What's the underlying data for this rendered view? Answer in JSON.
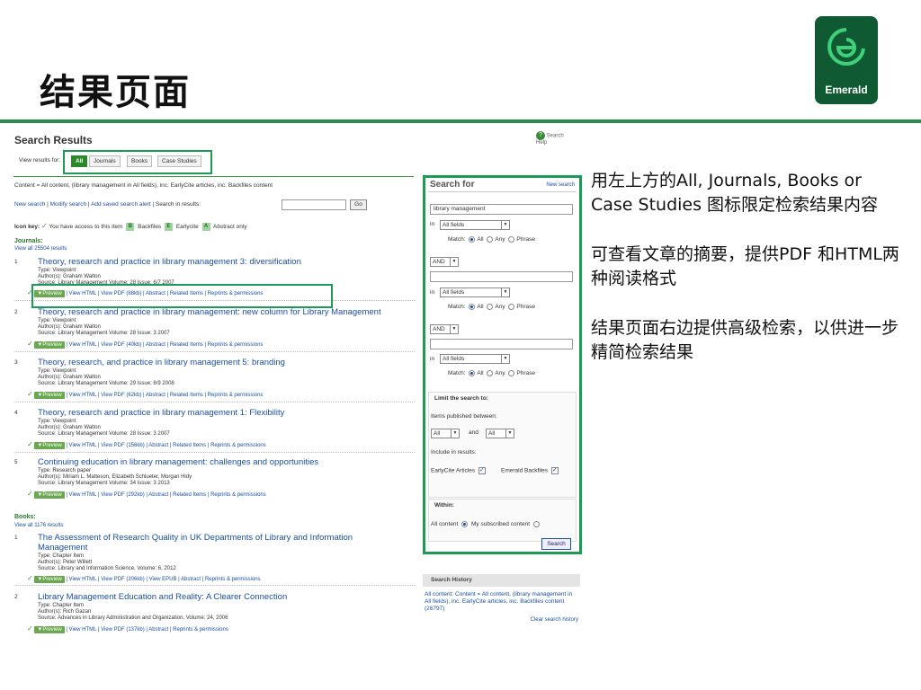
{
  "slide_title": "结果页面",
  "logo": {
    "text": "Emerald",
    "brand_color": "#0f5a32",
    "accent": "#1d9a55"
  },
  "screenshot": {
    "title": "Search Results",
    "help": "Search Help",
    "view_results_for": "View results for:",
    "tabs": [
      "All",
      "Journals",
      "Books",
      "Case Studies"
    ],
    "content_line": "Content = All content, (library management in All fields), inc. EarlyCite articles, inc. Backfiles content",
    "links": {
      "new_search": "New search",
      "modify_search": "Modify search",
      "add_alert": "Add saved search alert",
      "search_in_results": "Search in results:",
      "go": "Go"
    },
    "icon_key": {
      "label": "Icon key:",
      "access": "You have access to this item",
      "b": "B",
      "backfiles": "Backfiles",
      "e": "E",
      "earlycite": "Earlycite",
      "a": "A",
      "abstract_only": "Abstract only"
    },
    "journals": {
      "heading": "Journals:",
      "view_all": "View all 25504 results",
      "results": [
        {
          "num": "1",
          "title": "Theory, research and practice in library management 3: diversification",
          "type": "Type: Viewpoint",
          "authors": "Author(s): Graham Walton",
          "source": "Source: Library Management Volume: 28 Issue: 6/7 2007",
          "actions": "| View HTML | View PDF (88kb) | Abstract | Related Items | Reprints & permissions"
        },
        {
          "num": "2",
          "title": "Theory, research and practice in library management: new column for Library Management",
          "type": "Type: Viewpoint",
          "authors": "Author(s): Graham Walton",
          "source": "Source: Library Management Volume: 28 Issue: 3 2007",
          "actions": "| View HTML | View PDF (40kb) | Abstract | Related Items | Reprints & permissions"
        },
        {
          "num": "3",
          "title": "Theory, research, and practice in library management 5: branding",
          "type": "Type: Viewpoint",
          "authors": "Author(s): Graham Walton",
          "source": "Source: Library Management Volume: 29 Issue: 8/9 2008",
          "actions": "| View HTML | View PDF (62kb) | Abstract | Related Items | Reprints & permissions"
        },
        {
          "num": "4",
          "title": "Theory, research and practice in library management 1: Flexibility",
          "type": "Type: Viewpoint",
          "authors": "Author(s): Graham Walton",
          "source": "Source: Library Management Volume: 28 Issue: 3 2007",
          "actions": "| View HTML | View PDF (156kb) | Abstract | Related Items | Reprints & permissions"
        },
        {
          "num": "5",
          "title": "Continuing education in library management: challenges and opportunities",
          "type": "Type: Research paper",
          "authors": "Author(s): Miriam L. Matteson, Elizabeth Schlueter, Morgan Hidy",
          "source": "Source: Library Management Volume: 34 Issue: 3 2013",
          "actions": "| View HTML | View PDF (292kb) | Abstract | Related Items | Reprints & permissions"
        }
      ]
    },
    "books": {
      "heading": "Books:",
      "view_all": "View all 1176 results",
      "results": [
        {
          "num": "1",
          "title": "The Assessment of Research Quality in UK Departments of Library and Information Management",
          "type": "Type: Chapter Item",
          "authors": "Author(s): Peter Willett",
          "source": "Source: Library and Information Science, Volume: 6, 2012",
          "actions": "| View HTML | View PDF (206kb) | View EPUB | Abstract | Reprints & permissions"
        },
        {
          "num": "2",
          "title": "Library Management Education and Reality: A Clearer Connection",
          "type": "Type: Chapter Item",
          "authors": "Author(s): Rich Gazan",
          "source": "Source: Advances in Library Administration and Organization, Volume: 24, 2006",
          "actions": "| View HTML | View PDF (137kb) | Abstract | Reprints & permissions"
        }
      ]
    },
    "preview_label": "▼Preview",
    "search_panel": {
      "title": "Search for",
      "new_search": "New search",
      "query": "library management",
      "in": "in",
      "field": "All fields",
      "match": "Match:",
      "all": "All",
      "any": "Any",
      "phrase": "Phrase",
      "op": "AND",
      "limit_title": "Limit the search to:",
      "published_between": "Items published between:",
      "from": "All",
      "and": "and",
      "to": "All",
      "include": "Include in results:",
      "earlycite": "EarlyCite Articles",
      "backfiles": "Emerald Backfiles",
      "within": "Within:",
      "all_content": "All content",
      "subscribed": "My subscribed content",
      "search_btn": "Search"
    },
    "history": {
      "title": "Search History",
      "entry": "All content: Content = All content, (library management in All fields), inc. EarlyCite articles, inc. Backfiles content (26797)",
      "clear": "Clear search history"
    }
  },
  "notes": [
    "用左上方的All, Journals, Books or Case Studies 图标限定检索结果内容",
    "可查看文章的摘要，提供PDF 和HTML两种阅读格式",
    "结果页面右边提供高级检索，以供进一步精简检索结果"
  ]
}
